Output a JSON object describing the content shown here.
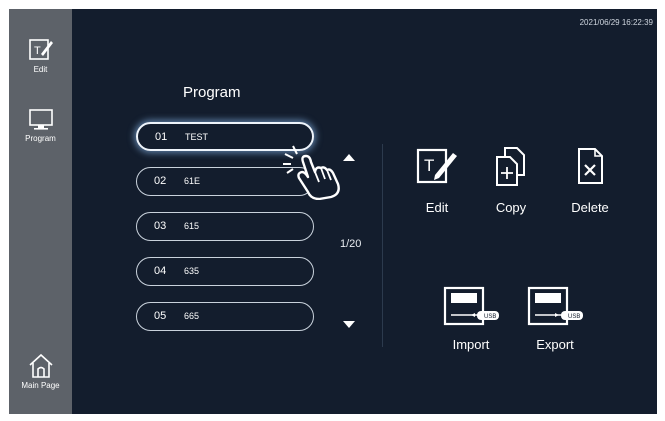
{
  "sidebar": {
    "items": [
      {
        "label": "Edit",
        "icon": "edit-icon"
      },
      {
        "label": "Program",
        "icon": "monitor-icon"
      },
      {
        "label": "Main Page",
        "icon": "home-icon"
      }
    ]
  },
  "header": {
    "timestamp": "2021/06/29 16:22:39"
  },
  "program_list": {
    "title": "Program",
    "items": [
      {
        "number": "01",
        "name": "TEST",
        "selected": true
      },
      {
        "number": "02",
        "name": "61E",
        "selected": false
      },
      {
        "number": "03",
        "name": "615",
        "selected": false
      },
      {
        "number": "04",
        "name": "635",
        "selected": false
      },
      {
        "number": "05",
        "name": "665",
        "selected": false
      }
    ],
    "page": "1/20"
  },
  "actions": {
    "edit_label": "Edit",
    "copy_label": "Copy",
    "delete_label": "Delete",
    "import_label": "Import",
    "export_label": "Export",
    "usb_text": "USB"
  },
  "colors": {
    "background": "#131d2d",
    "sidebar": "#5d6269",
    "text": "#ffffff",
    "outline": "#c9d2dc"
  }
}
